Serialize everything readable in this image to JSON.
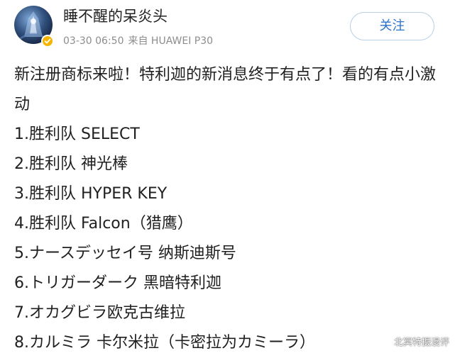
{
  "post": {
    "user": {
      "name": "睡不醒的呆炎头",
      "avatar_icon": "avatar-image",
      "verified_badge_color": "#f6b400"
    },
    "meta": {
      "date_time": "03-30 06:50",
      "source": "来自 HUAWEI P30"
    },
    "follow_button_label": "关注",
    "body": {
      "intro": "新注册商标来啦！特利迦的新消息终于有点了！看的有点小激动",
      "items": [
        "1.胜利队 SELECT",
        "2.胜利队 神光棒",
        "3.胜利队 HYPER KEY",
        "4.胜利队 Falcon（猎鹰）",
        "5.ナースデッセイ号 纳斯迪斯号",
        "6.トリガーダーク 黑暗特利迦",
        "7.オカグビラ欧克古维拉",
        "8.カルミラ 卡尔米拉（卡密拉为カミーラ）"
      ]
    }
  },
  "watermark": "北冥特摄漫评",
  "colors": {
    "accent": "#2b73c9",
    "follow_border": "#b9cfe5",
    "meta_text": "#8d8d8d",
    "body_text": "#1f1f1f"
  }
}
